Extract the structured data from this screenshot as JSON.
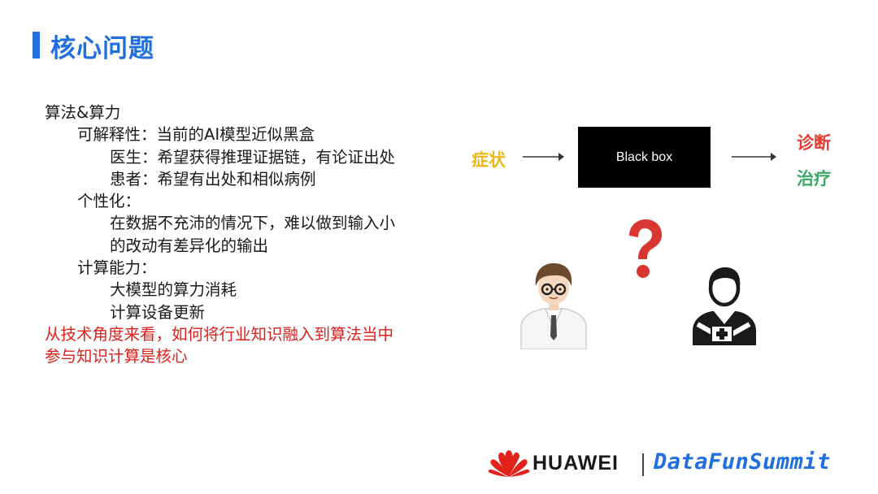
{
  "title": "核心问题",
  "outline": [
    {
      "level": 1,
      "text": "算法&算力",
      "emphasis": false
    },
    {
      "level": 2,
      "text": "可解释性：当前的AI模型近似黑盒",
      "emphasis": false
    },
    {
      "level": 3,
      "text": "医生：希望获得推理证据链，有论证出处",
      "emphasis": false
    },
    {
      "level": 3,
      "text": "患者：希望有出处和相似病例",
      "emphasis": false
    },
    {
      "level": 2,
      "text": "个性化：",
      "emphasis": false
    },
    {
      "level": 3,
      "text": "在数据不充沛的情况下，难以做到输入小",
      "emphasis": false
    },
    {
      "level": 3,
      "text": "的改动有差异化的输出",
      "emphasis": false
    },
    {
      "level": 2,
      "text": "计算能力：",
      "emphasis": false
    },
    {
      "level": 3,
      "text": "大模型的算力消耗",
      "emphasis": false
    },
    {
      "level": 3,
      "text": "计算设备更新",
      "emphasis": false
    },
    {
      "level": 1,
      "text": "从技术角度来看，如何将行业知识融入到算法当中",
      "emphasis": true
    },
    {
      "level": 1,
      "text": "参与知识计算是核心",
      "emphasis": true
    }
  ],
  "diagram": {
    "input_label": "症状",
    "box_label": "Black box",
    "output_labels": [
      "诊断",
      "治疗"
    ]
  },
  "icons": [
    "doctor-icon",
    "question-mark-icon",
    "patient-icon",
    "huawei-logo-icon"
  ],
  "footer": {
    "brand": "HUAWEI",
    "summit": "DataFunSummit"
  },
  "colors": {
    "accent_blue": "#1f6fe0",
    "emphasis_red": "#e0201b",
    "symptom_yellow": "#e9b81c",
    "diagnosis_red": "#e63b2e",
    "treatment_green": "#3aa867"
  }
}
